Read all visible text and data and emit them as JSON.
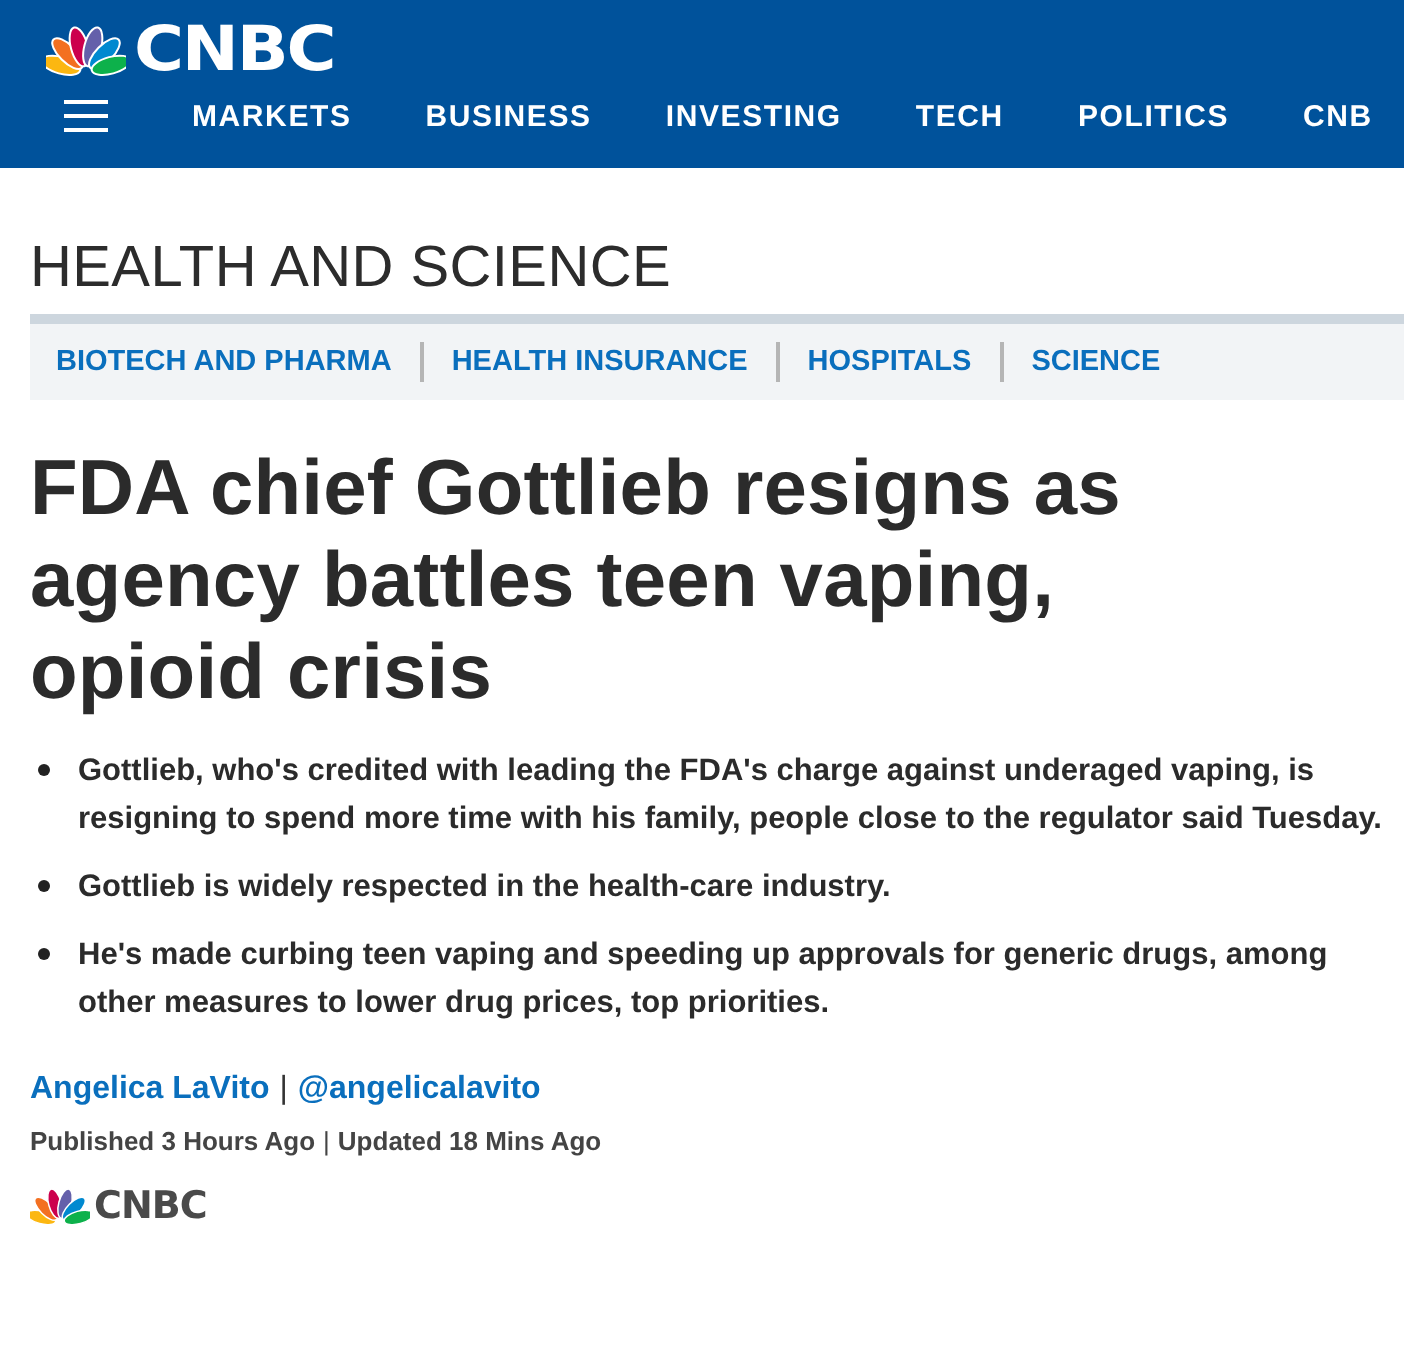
{
  "header": {
    "logo_text": "CNBC",
    "nav": [
      "MARKETS",
      "BUSINESS",
      "INVESTING",
      "TECH",
      "POLITICS",
      "CNB"
    ]
  },
  "section": {
    "title": "HEALTH AND SCIENCE",
    "subnav": [
      "BIOTECH AND PHARMA",
      "HEALTH INSURANCE",
      "HOSPITALS",
      "SCIENCE"
    ]
  },
  "article": {
    "headline": "FDA chief Gottlieb resigns as agency battles teen vaping, opioid crisis",
    "key_points": [
      "Gottlieb, who's credited with leading the FDA's charge against underaged vaping, is resigning to spend more time with his family, people close to the regulator said Tuesday.",
      "Gottlieb is widely respected in the health-care industry.",
      "He's made curbing teen vaping and speeding up approvals for generic drugs, among other measures to lower drug prices, top priorities."
    ],
    "author": "Angelica LaVito",
    "separator": "|",
    "handle": "@angelicalavito",
    "published": "Published 3 Hours Ago",
    "updated": "Updated 18 Mins Ago"
  },
  "footer": {
    "logo_text": "CNBC"
  }
}
